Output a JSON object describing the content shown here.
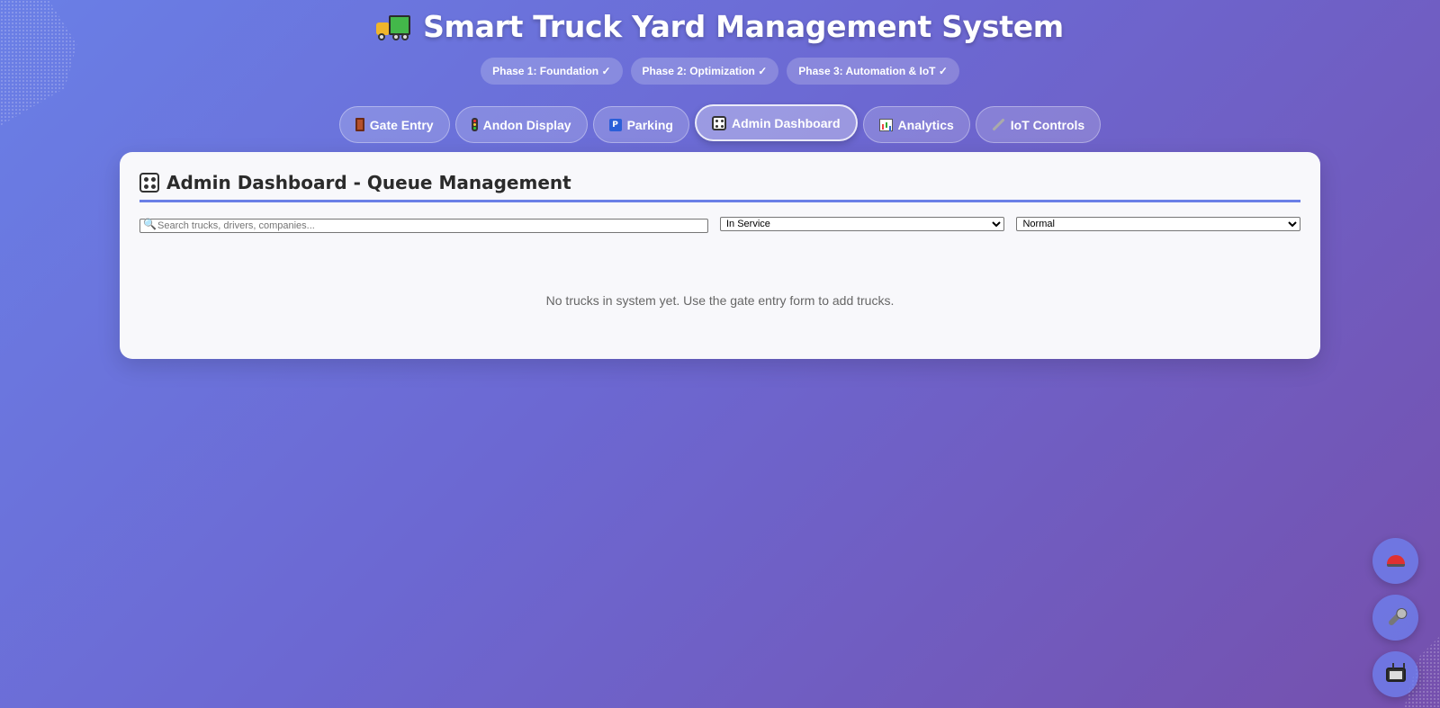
{
  "header": {
    "title": "Smart Truck Yard Management System",
    "icon": "truck-icon",
    "phases": [
      "Phase 1: Foundation ✓",
      "Phase 2: Optimization ✓",
      "Phase 3: Automation & IoT ✓"
    ]
  },
  "nav": {
    "tabs": [
      {
        "label": "Gate Entry",
        "icon": "door-icon"
      },
      {
        "label": "Andon Display",
        "icon": "traffic-light-icon"
      },
      {
        "label": "Parking",
        "icon": "parking-icon"
      },
      {
        "label": "Admin Dashboard",
        "icon": "dashboard-icon",
        "active": true
      },
      {
        "label": "Analytics",
        "icon": "chart-icon"
      },
      {
        "label": "IoT Controls",
        "icon": "wrench-icon"
      }
    ]
  },
  "main": {
    "title": "Admin Dashboard - Queue Management",
    "search": {
      "placeholder": "Search trucks, drivers, companies...",
      "value": ""
    },
    "status_filter": "In Service",
    "priority_filter": "Normal",
    "empty_message": "No trucks in system yet. Use the gate entry form to add trucks."
  },
  "fabs": [
    "alarm-icon",
    "microphone-icon",
    "tv-icon"
  ],
  "colors": {
    "accent": "#6a7fe6",
    "bg_start": "#6a7fe6",
    "bg_end": "#7550ad",
    "panel_bg": "#f8f8fb"
  }
}
